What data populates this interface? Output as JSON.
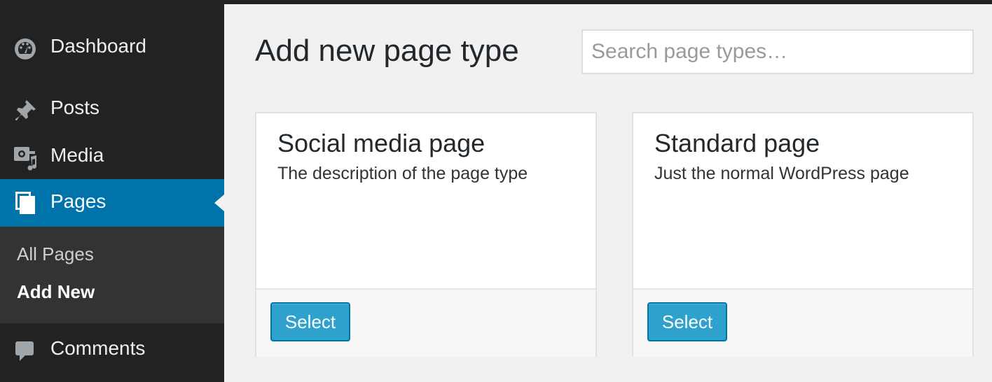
{
  "sidebar": {
    "items": [
      {
        "label": "Dashboard",
        "icon": "dashboard-icon"
      },
      {
        "label": "Posts",
        "icon": "pin-icon"
      },
      {
        "label": "Media",
        "icon": "media-icon"
      },
      {
        "label": "Pages",
        "icon": "pages-icon",
        "active": true
      },
      {
        "label": "Comments",
        "icon": "comment-icon"
      }
    ],
    "submenu": [
      {
        "label": "All Pages"
      },
      {
        "label": "Add New",
        "current": true
      }
    ]
  },
  "main": {
    "title": "Add new page type",
    "search": {
      "placeholder": "Search page types…",
      "value": ""
    },
    "cards": [
      {
        "title": "Social media page",
        "description": "The description of the page type",
        "button": "Select"
      },
      {
        "title": "Standard page",
        "description": "Just the normal WordPress page",
        "button": "Select"
      }
    ]
  },
  "colors": {
    "sidebar_bg": "#222222",
    "submenu_bg": "#333333",
    "active_bg": "#0073aa",
    "button_bg": "#2ea2cc",
    "page_bg": "#f1f1f1"
  }
}
